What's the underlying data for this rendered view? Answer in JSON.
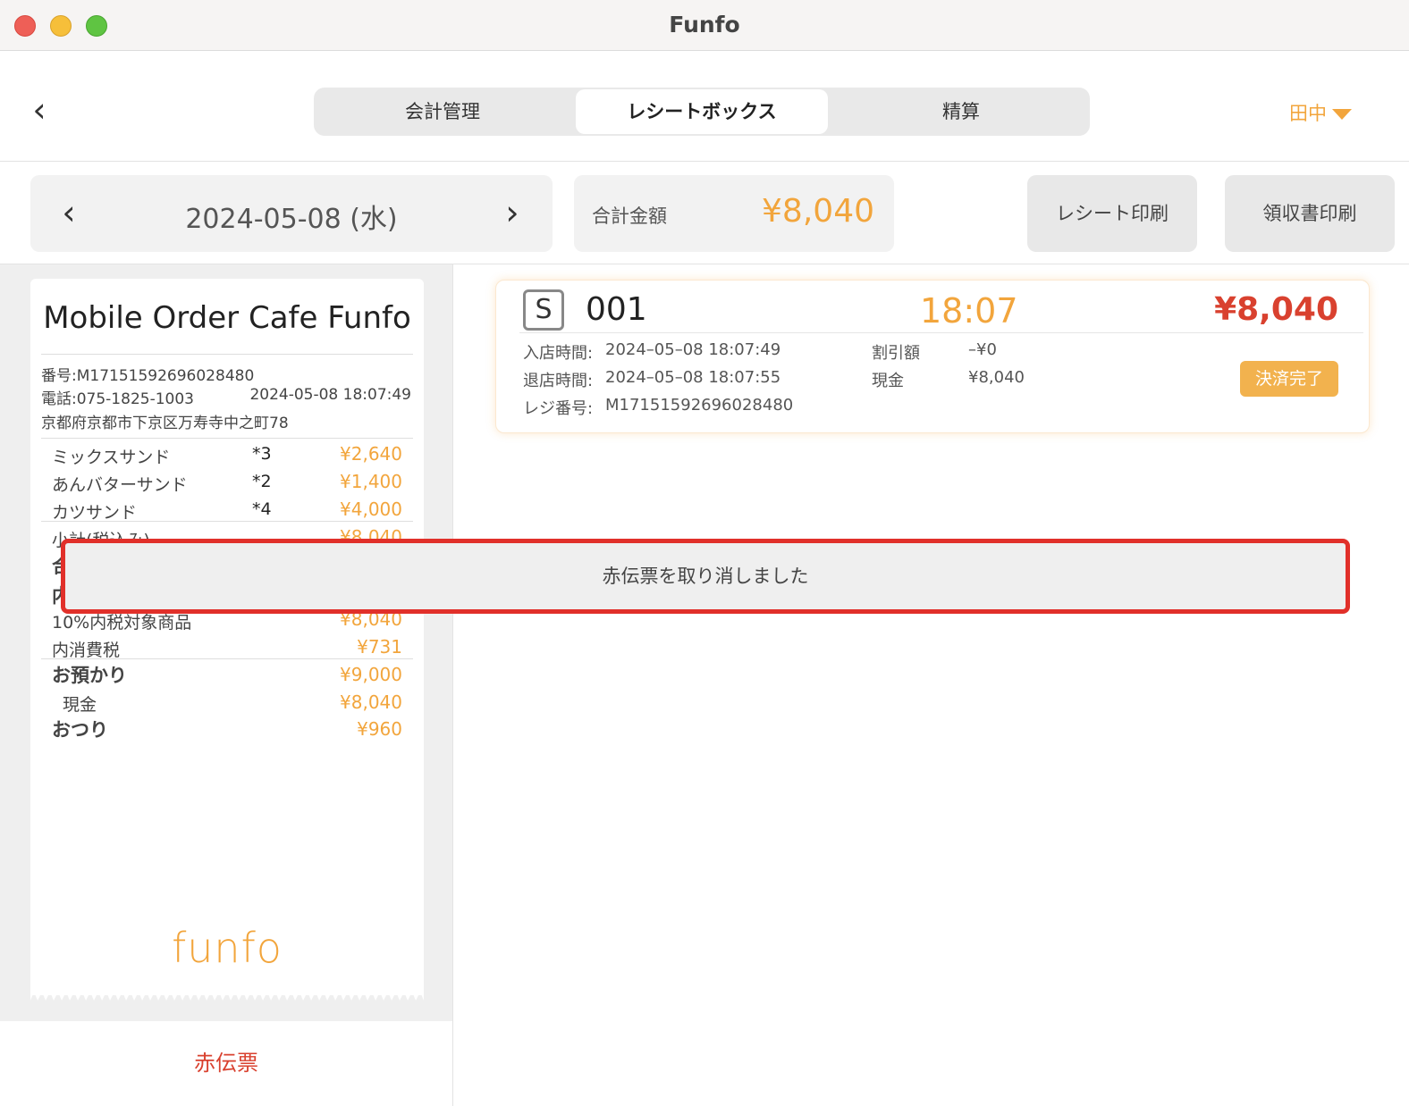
{
  "window": {
    "title": "Funfo"
  },
  "header": {
    "tabs": [
      {
        "label": "会計管理"
      },
      {
        "label": "レシートボックス"
      },
      {
        "label": "精算"
      }
    ],
    "user": "田中"
  },
  "toolbar": {
    "date": "2024-05-08 (水)",
    "total_label": "合計金額",
    "total_value": "¥8,040",
    "print_receipt": "レシート印刷",
    "print_ryoshu": "領収書印刷"
  },
  "receipt": {
    "shop_name": "Mobile Order Cafe Funfo",
    "number": "番号:M17151592696028480",
    "phone": "電話:075-1825-1003",
    "datetime": "2024-05-08 18:07:49",
    "address": "京都府京都市下京区万寿寺中之町78",
    "items": [
      {
        "name": "ミックスサンド",
        "qty": "*3",
        "price": "¥2,640"
      },
      {
        "name": "あんバターサンド",
        "qty": "*2",
        "price": "¥1,400"
      },
      {
        "name": "カツサンド",
        "qty": "*4",
        "price": "¥4,000"
      }
    ],
    "subtotal_label": "小計(税込み)",
    "subtotal_value": "¥8,040",
    "hidden_label_1": "合",
    "hidden_label_2": "内",
    "taxable_label": "10%内税対象商品",
    "taxable_value": "¥8,040",
    "tax_label": "内消費税",
    "tax_value": "¥731",
    "deposit_label": "お預かり",
    "deposit_value": "¥9,000",
    "cash_label": "現金",
    "cash_value": "¥8,040",
    "change_label": "おつり",
    "change_value": "¥960",
    "logo": "funfo"
  },
  "red_slip_button": "赤伝票",
  "order": {
    "badge": "S",
    "number": "001",
    "time": "18:07",
    "amount": "¥8,040",
    "checkin_label": "入店時間:",
    "checkin_value": "2024–05–08 18:07:49",
    "checkout_label": "退店時間:",
    "checkout_value": "2024–05–08 18:07:55",
    "register_label": "レジ番号:",
    "register_value": "M17151592696028480",
    "discount_label": "割引額",
    "discount_value": "–¥0",
    "cash_label": "現金",
    "cash_value": "¥8,040",
    "status": "決済完了"
  },
  "toast": {
    "message": "赤伝票を取り消しました"
  },
  "colors": {
    "accent": "#f2a53c",
    "red": "#d9412f",
    "toast_border": "#e1302a"
  }
}
